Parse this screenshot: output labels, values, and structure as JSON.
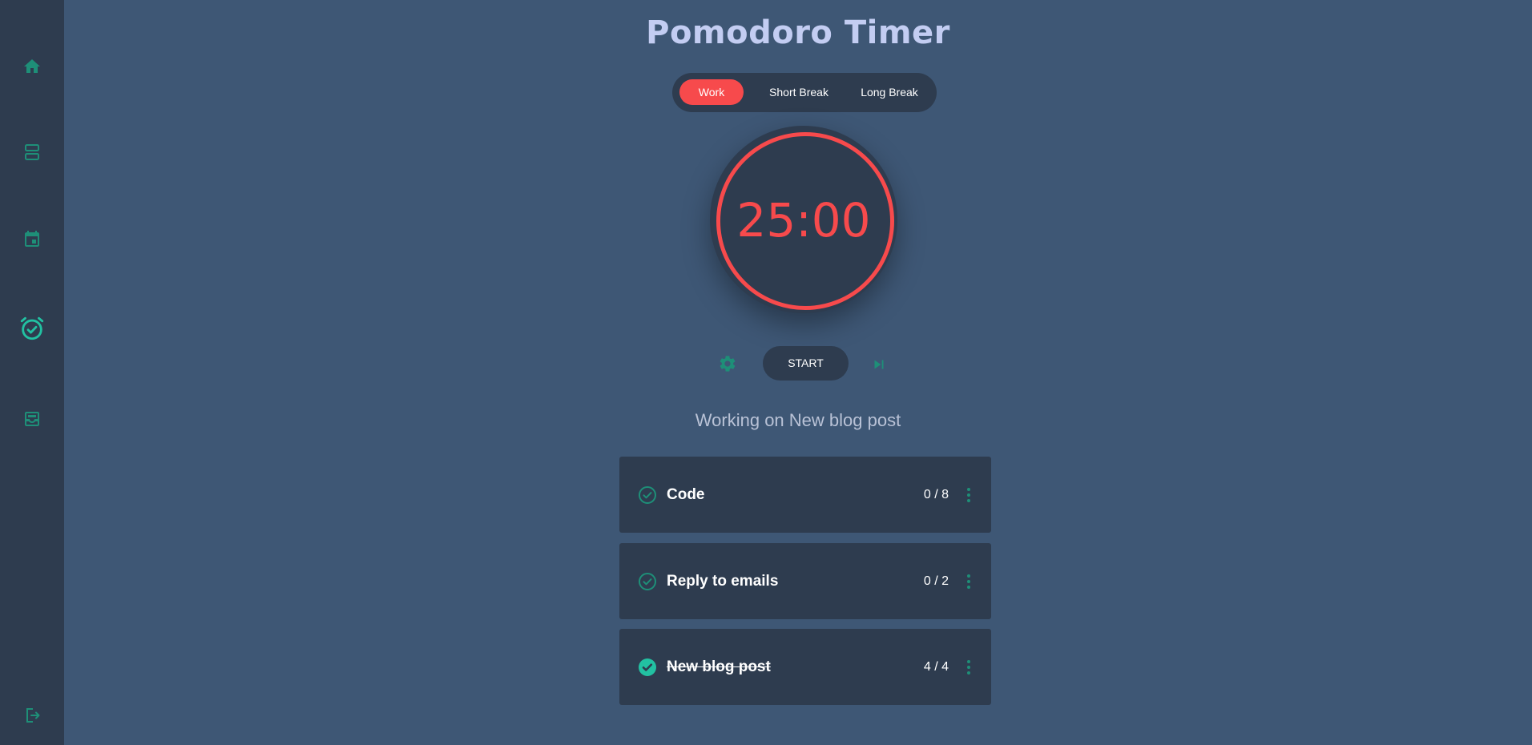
{
  "app": {
    "title": "Pomodoro Timer"
  },
  "sidebar": {
    "items": [
      {
        "icon": "home-icon",
        "active": false
      },
      {
        "icon": "dashboard-icon",
        "active": false
      },
      {
        "icon": "calendar-icon",
        "active": false
      },
      {
        "icon": "alarm-check-icon",
        "active": true
      },
      {
        "icon": "inbox-icon",
        "active": false
      }
    ],
    "logout_icon": "logout-icon"
  },
  "modes": {
    "tabs": [
      {
        "label": "Work",
        "active": true
      },
      {
        "label": "Short Break",
        "active": false
      },
      {
        "label": "Long Break",
        "active": false
      }
    ]
  },
  "timer": {
    "display": "25:00",
    "start_label": "START",
    "settings_icon": "gear-icon",
    "skip_icon": "skip-next-icon"
  },
  "status": {
    "working_text": "Working on New blog post"
  },
  "tasks": [
    {
      "name": "Code",
      "count": "0 / 8",
      "completed": false
    },
    {
      "name": "Reply to emails",
      "count": "0 / 2",
      "completed": false
    },
    {
      "name": "New blog post",
      "count": "4 / 4",
      "completed": true
    }
  ],
  "colors": {
    "background": "#3e5775",
    "panel": "#2e3c4f",
    "accent": "#f74a4c",
    "icon_teal": "#1e8f78",
    "active_teal": "#22c1a2",
    "title": "#c3cdf2"
  }
}
